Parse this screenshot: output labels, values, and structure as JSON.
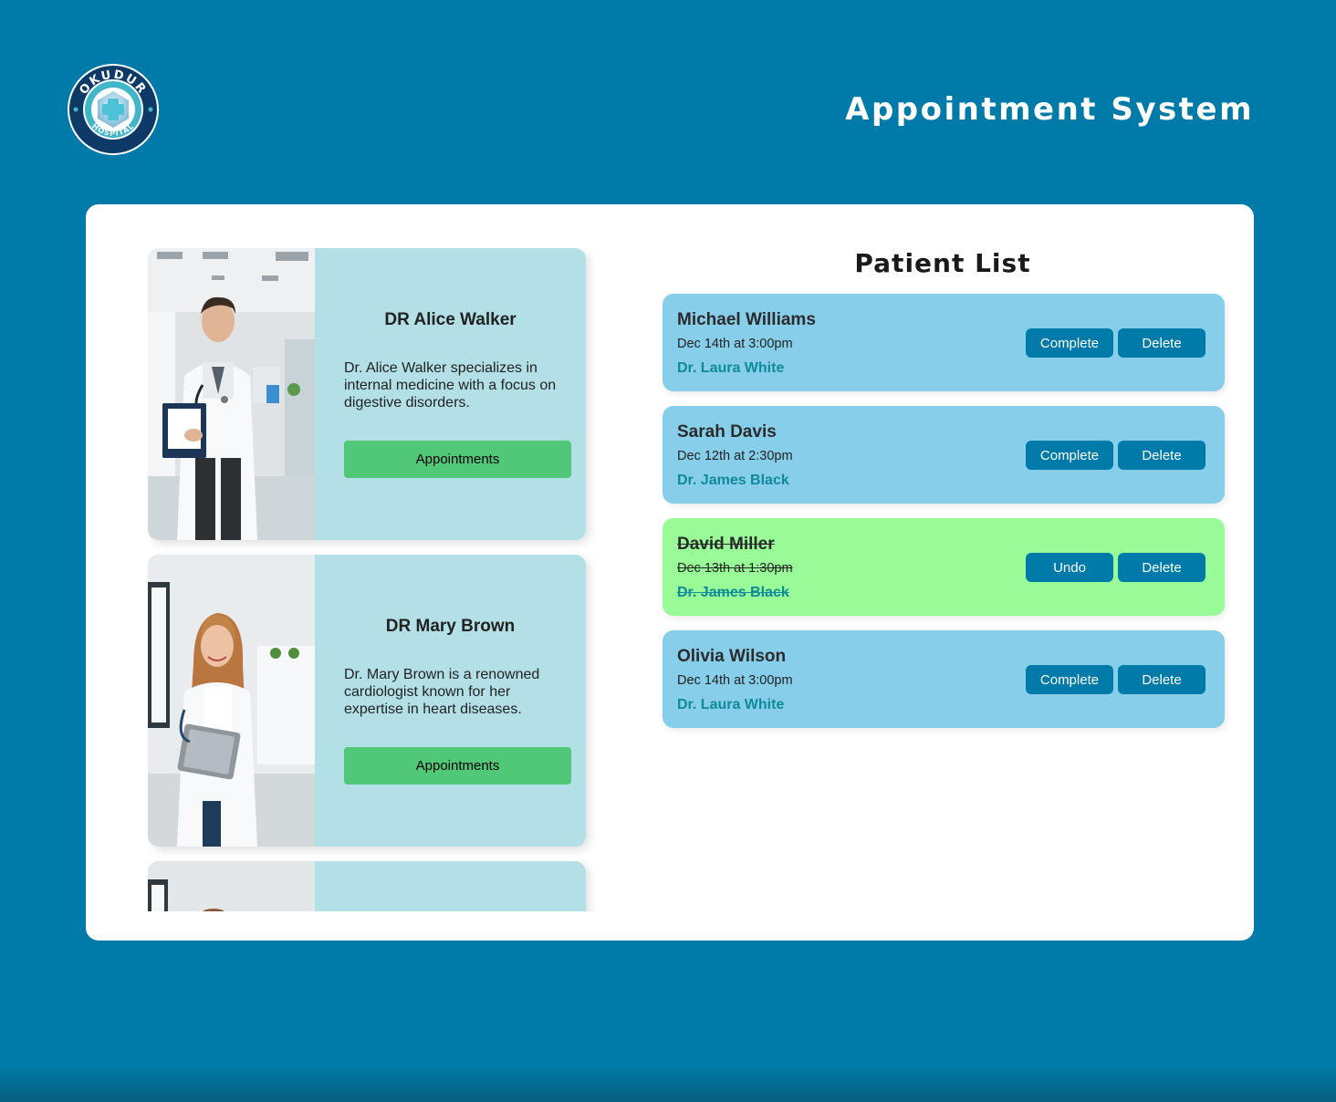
{
  "header": {
    "logo_text_top": "OKUDUR",
    "logo_text_bottom": "HOSPITAL",
    "title": "Appointment System"
  },
  "doctors": [
    {
      "name": "DR Alice Walker",
      "description": "Dr. Alice Walker specializes in internal medicine with a focus on digestive disorders.",
      "button_label": "Appointments",
      "photo": "male-doctor-photo"
    },
    {
      "name": "DR Mary Brown",
      "description": "Dr. Mary Brown is a renowned cardiologist known for her expertise in heart diseases.",
      "button_label": "Appointments",
      "photo": "female-doctor-photo"
    },
    {
      "name": "",
      "description": "",
      "button_label": "",
      "photo": "doctor-photo"
    }
  ],
  "patient_list": {
    "title": "Patient List",
    "patients": [
      {
        "name": "Michael Williams",
        "date": "Dec 14th at 3:00pm",
        "doctor": "Dr. Laura White",
        "primary_label": "Complete",
        "delete_label": "Delete",
        "completed": false
      },
      {
        "name": "Sarah Davis",
        "date": "Dec 12th at 2:30pm",
        "doctor": "Dr. James Black",
        "primary_label": "Complete",
        "delete_label": "Delete",
        "completed": false
      },
      {
        "name": "David Miller",
        "date": "Dec 13th at 1:30pm",
        "doctor": "Dr. James Black",
        "primary_label": "Undo",
        "delete_label": "Delete",
        "completed": true
      },
      {
        "name": "Olivia Wilson",
        "date": "Dec 14th at 3:00pm",
        "doctor": "Dr. Laura White",
        "primary_label": "Complete",
        "delete_label": "Delete",
        "completed": false
      }
    ]
  },
  "colors": {
    "background": "#007aa8",
    "card": "#b2e0e6",
    "patient_card": "#87ceeb",
    "patient_card_completed": "#98fb98",
    "appointments_button": "#50c878",
    "action_button": "#007aa8",
    "doctor_link": "#0e8a9a"
  }
}
